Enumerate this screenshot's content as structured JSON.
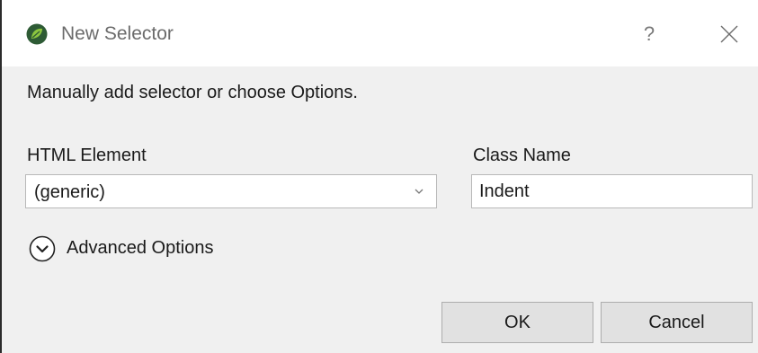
{
  "window": {
    "title": "New Selector",
    "help_label": "?",
    "icon": "app-leaf-icon",
    "close_icon": "close-icon",
    "accent_color": "#2e8b3e"
  },
  "main": {
    "instruction": "Manually add selector or choose Options.",
    "html_element": {
      "label": "HTML Element",
      "selected": "(generic)"
    },
    "class_name": {
      "label": "Class Name",
      "value": "Indent"
    },
    "advanced": {
      "label": "Advanced Options",
      "icon": "chevron-down-circle-icon"
    }
  },
  "buttons": {
    "ok": "OK",
    "cancel": "Cancel"
  }
}
